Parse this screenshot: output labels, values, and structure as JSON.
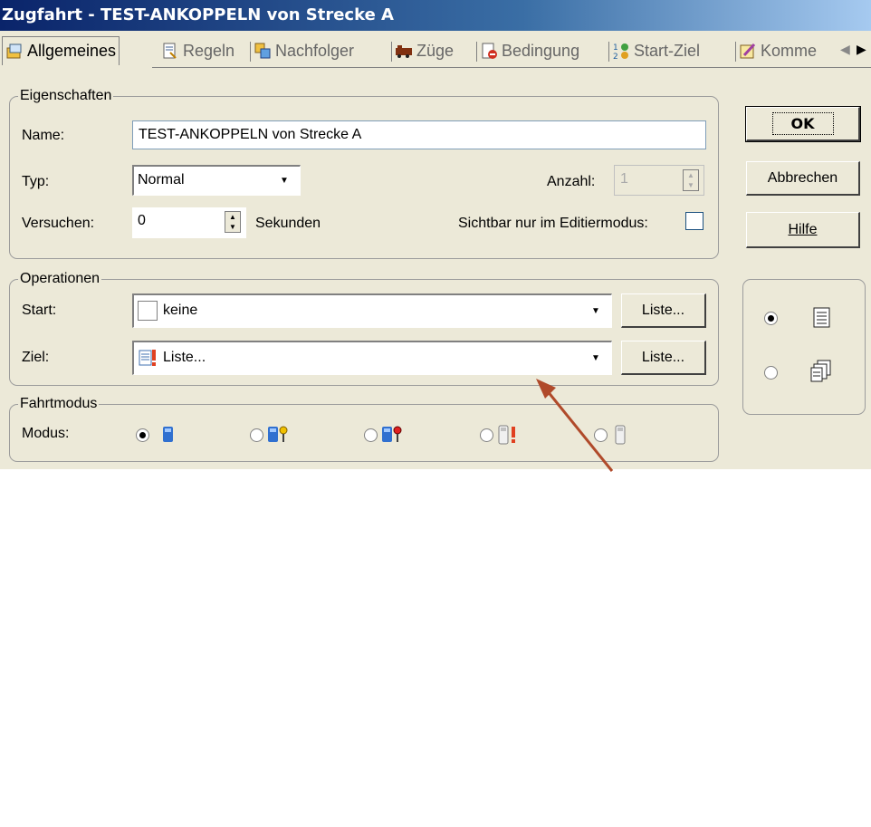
{
  "window": {
    "title": "Zugfahrt - TEST-ANKOPPELN von Strecke A"
  },
  "tabs": [
    {
      "label": "Allgemeines",
      "icon": "general-icon"
    },
    {
      "label": "Regeln",
      "icon": "rules-icon"
    },
    {
      "label": "Nachfolger",
      "icon": "successor-icon"
    },
    {
      "label": "Züge",
      "icon": "trains-icon"
    },
    {
      "label": "Bedingung",
      "icon": "condition-icon"
    },
    {
      "label": "Start-Ziel",
      "icon": "start-goal-icon"
    },
    {
      "label": "Komme",
      "icon": "comment-icon"
    }
  ],
  "eigenschaften": {
    "legend": "Eigenschaften",
    "name_label": "Name:",
    "name_value": "TEST-ANKOPPELN von Strecke A",
    "typ_label": "Typ:",
    "typ_value": "Normal",
    "anzahl_label": "Anzahl:",
    "anzahl_value": "1",
    "versuchen_label": "Versuchen:",
    "versuchen_value": "0",
    "sekunden_label": "Sekunden",
    "sichtbar_label": "Sichtbar nur im Editiermodus:"
  },
  "operationen": {
    "legend": "Operationen",
    "start_label": "Start:",
    "start_value": "keine",
    "ziel_label": "Ziel:",
    "ziel_value": "Liste...",
    "liste_button": "Liste..."
  },
  "fahrtmodus": {
    "legend": "Fahrtmodus",
    "modus_label": "Modus:"
  },
  "buttons": {
    "ok": "OK",
    "cancel": "Abbrechen",
    "help": "Hilfe"
  },
  "colors": {
    "titlebar": "#0a246a",
    "arrow": "#b04a2a",
    "panel": "#ece9d8"
  }
}
